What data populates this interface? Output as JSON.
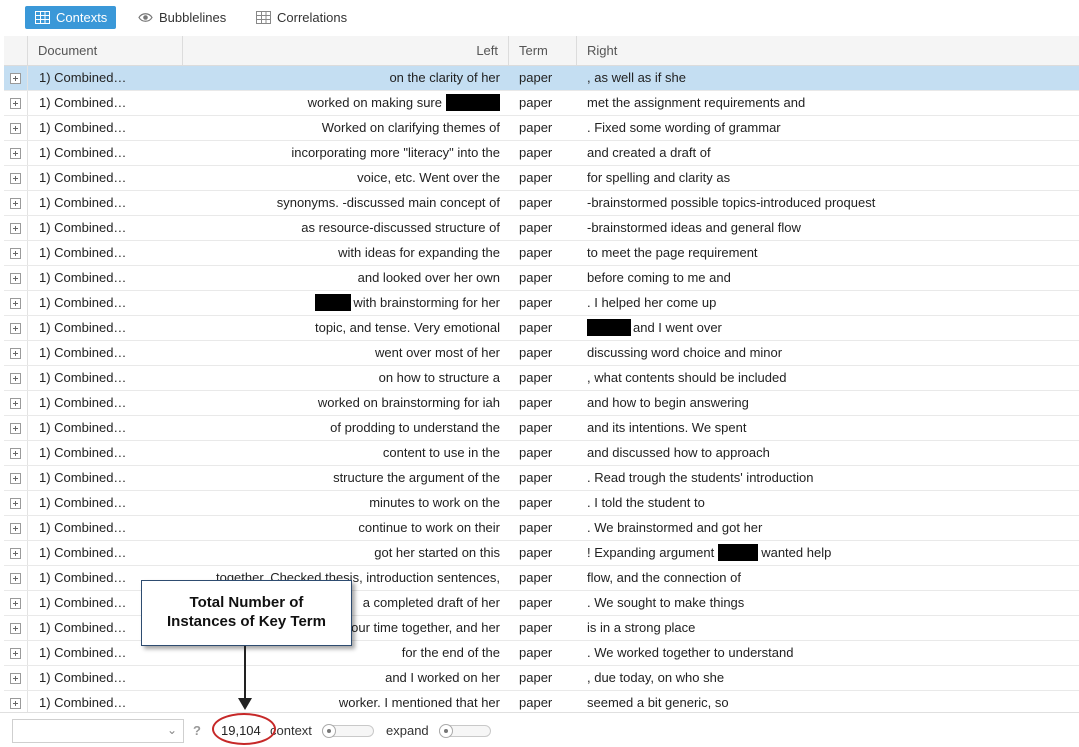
{
  "tabs": [
    {
      "label": "Contexts",
      "icon": "table-icon",
      "active": true
    },
    {
      "label": "Bubblelines",
      "icon": "eye-icon",
      "active": false
    },
    {
      "label": "Correlations",
      "icon": "table-icon",
      "active": false
    }
  ],
  "columns": {
    "document": "Document",
    "left": "Left",
    "term": "Term",
    "right": "Right"
  },
  "rows": [
    {
      "doc": "1) Combined…",
      "left": "on the clarity of her",
      "term": "paper",
      "right": ", as well as if she"
    },
    {
      "doc": "1) Combined…",
      "left": "worked on making sure",
      "term": "paper",
      "right": "met the assignment requirements and"
    },
    {
      "doc": "1) Combined…",
      "left": "Worked on clarifying themes of",
      "term": "paper",
      "right": ". Fixed some wording of grammar"
    },
    {
      "doc": "1) Combined…",
      "left": "incorporating more \"literacy\" into the",
      "term": "paper",
      "right": "and created a draft of"
    },
    {
      "doc": "1) Combined…",
      "left": "voice, etc. Went over the",
      "term": "paper",
      "right": "for spelling and clarity as"
    },
    {
      "doc": "1) Combined…",
      "left": "synonyms. -discussed main concept of",
      "term": "paper",
      "right": "-brainstormed possible topics-introduced proquest"
    },
    {
      "doc": "1) Combined…",
      "left": "as resource-discussed structure of",
      "term": "paper",
      "right": "-brainstormed ideas and general flow"
    },
    {
      "doc": "1) Combined…",
      "left": "with ideas for expanding the",
      "term": "paper",
      "right": "to meet the page requirement"
    },
    {
      "doc": "1) Combined…",
      "left": "and looked over her own",
      "term": "paper",
      "right": "before coming to me and"
    },
    {
      "doc": "1) Combined…",
      "left": "with brainstorming for her",
      "term": "paper",
      "right": ". I helped her come up"
    },
    {
      "doc": "1) Combined…",
      "left": "topic, and tense. Very emotional",
      "term": "paper",
      "right": "and I went over"
    },
    {
      "doc": "1) Combined…",
      "left": "went over most of her",
      "term": "paper",
      "right": "discussing word choice and minor"
    },
    {
      "doc": "1) Combined…",
      "left": "on how to structure a",
      "term": "paper",
      "right": ", what contents should be included"
    },
    {
      "doc": "1) Combined…",
      "left": "worked on brainstorming for iah",
      "term": "paper",
      "right": "and how to begin answering"
    },
    {
      "doc": "1) Combined…",
      "left": "of prodding to understand the",
      "term": "paper",
      "right": "and its intentions. We spent"
    },
    {
      "doc": "1) Combined…",
      "left": "content to use in the",
      "term": "paper",
      "right": "and discussed how to approach"
    },
    {
      "doc": "1) Combined…",
      "left": "structure the argument of the",
      "term": "paper",
      "right": ". Read trough the students' introduction"
    },
    {
      "doc": "1) Combined…",
      "left": "minutes to work on the",
      "term": "paper",
      "right": ". I told the student to"
    },
    {
      "doc": "1) Combined…",
      "left": "continue to work on their",
      "term": "paper",
      "right": ". We brainstormed and got her"
    },
    {
      "doc": "1) Combined…",
      "left": "got her started on this",
      "term": "paper",
      "right": "! Expanding argument"
    },
    {
      "doc": "1) Combined…",
      "left": "together. Checked thesis, introduction sentences,",
      "term": "paper",
      "right": "flow, and the connection of"
    },
    {
      "doc": "1) Combined…",
      "left": "a completed draft of her",
      "term": "paper",
      "right": ". We sought to make things"
    },
    {
      "doc": "1) Combined…",
      "left": "our time together, and her",
      "term": "paper",
      "right": "is in a strong place"
    },
    {
      "doc": "1) Combined…",
      "left": "for the end of the",
      "term": "paper",
      "right": ". We worked together to understand"
    },
    {
      "doc": "1) Combined…",
      "left": "and I worked on her",
      "term": "paper",
      "right": ", due today, on who she"
    },
    {
      "doc": "1) Combined…",
      "left": "worker. I mentioned that her",
      "term": "paper",
      "right": "seemed a bit generic, so"
    }
  ],
  "row19_right_suffix": "wanted help",
  "footer": {
    "document_select_value": "",
    "help_label": "?",
    "total_count": "19,104",
    "context_label": "context",
    "context_slider_level": 0,
    "expand_label": "expand",
    "expand_slider_level": 0
  },
  "annotation": {
    "text_line1": "Total Number of",
    "text_line2": "Instances of Key Term"
  },
  "colors": {
    "accent": "#3a98d8",
    "selected_row": "#c4def2",
    "annotation_circle": "#c62828",
    "annotation_border": "#2e4c70"
  }
}
